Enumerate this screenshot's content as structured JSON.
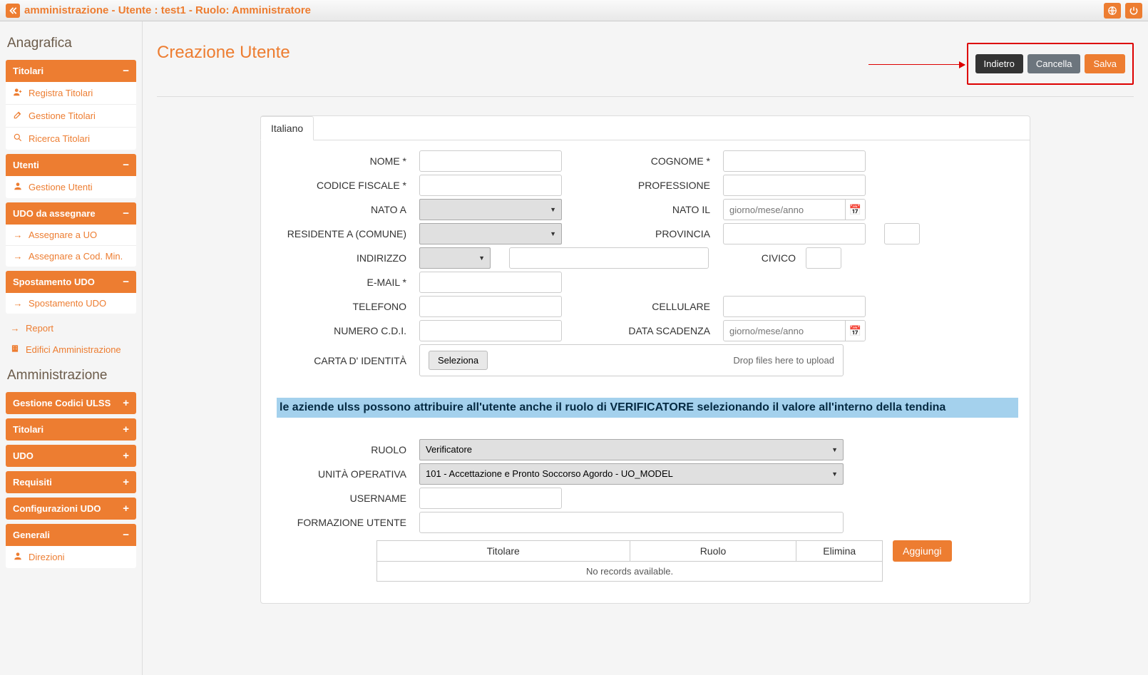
{
  "topbar": {
    "title": "amministrazione - Utente : test1 - Ruolo: Amministratore"
  },
  "sidebar": {
    "section1": "Anagrafica",
    "section2": "Amministrazione",
    "panels": {
      "titolari": {
        "label": "Titolari",
        "items": [
          "Registra Titolari",
          "Gestione Titolari",
          "Ricerca Titolari"
        ]
      },
      "utenti": {
        "label": "Utenti",
        "items": [
          "Gestione Utenti"
        ]
      },
      "udo_assegnare": {
        "label": "UDO da assegnare",
        "items": [
          "Assegnare a UO",
          "Assegnare a Cod. Min."
        ]
      },
      "spostamento": {
        "label": "Spostamento UDO",
        "items": [
          "Spostamento UDO"
        ]
      },
      "gest_codici": {
        "label": "Gestione Codici ULSS"
      },
      "titolari2": {
        "label": "Titolari"
      },
      "udo": {
        "label": "UDO"
      },
      "requisiti": {
        "label": "Requisiti"
      },
      "config_udo": {
        "label": "Configurazioni UDO"
      },
      "generali": {
        "label": "Generali",
        "items": [
          "Direzioni"
        ]
      }
    },
    "links": {
      "report": "Report",
      "edifici": "Edifici Amministrazione"
    }
  },
  "page": {
    "title": "Creazione Utente",
    "actions": {
      "back": "Indietro",
      "cancel": "Cancella",
      "save": "Salva"
    }
  },
  "form": {
    "tab": "Italiano",
    "labels": {
      "nome": "NOME *",
      "cognome": "COGNOME *",
      "codfisc": "CODICE FISCALE *",
      "professione": "PROFESSIONE",
      "natoa": "NATO A",
      "natoil": "NATO IL",
      "residente": "RESIDENTE A (COMUNE)",
      "provincia": "PROVINCIA",
      "indirizzo": "INDIRIZZO",
      "civico": "CIVICO",
      "email": "E-MAIL *",
      "telefono": "TELEFONO",
      "cellulare": "CELLULARE",
      "cdi": "NUMERO C.D.I.",
      "scadenza": "DATA SCADENZA",
      "carta": "CARTA D' IDENTITÀ",
      "ruolo": "RUOLO",
      "unita": "UNITÀ OPERATIVA",
      "username": "USERNAME",
      "formazione": "FORMAZIONE UTENTE"
    },
    "date_ph": "giorno/mese/anno",
    "file": {
      "btn": "Seleziona",
      "hint": "Drop files here to upload"
    },
    "note": "le aziende ulss possono attribuire all'utente anche il ruolo di VERIFICATORE selezionando il valore all'interno della tendina",
    "values": {
      "ruolo": "Verificatore",
      "unita": "101 - Accettazione e Pronto Soccorso Agordo - UO_MODEL"
    }
  },
  "table": {
    "cols": {
      "titolare": "Titolare",
      "ruolo": "Ruolo",
      "elimina": "Elimina"
    },
    "empty": "No records available.",
    "add": "Aggiungi"
  }
}
